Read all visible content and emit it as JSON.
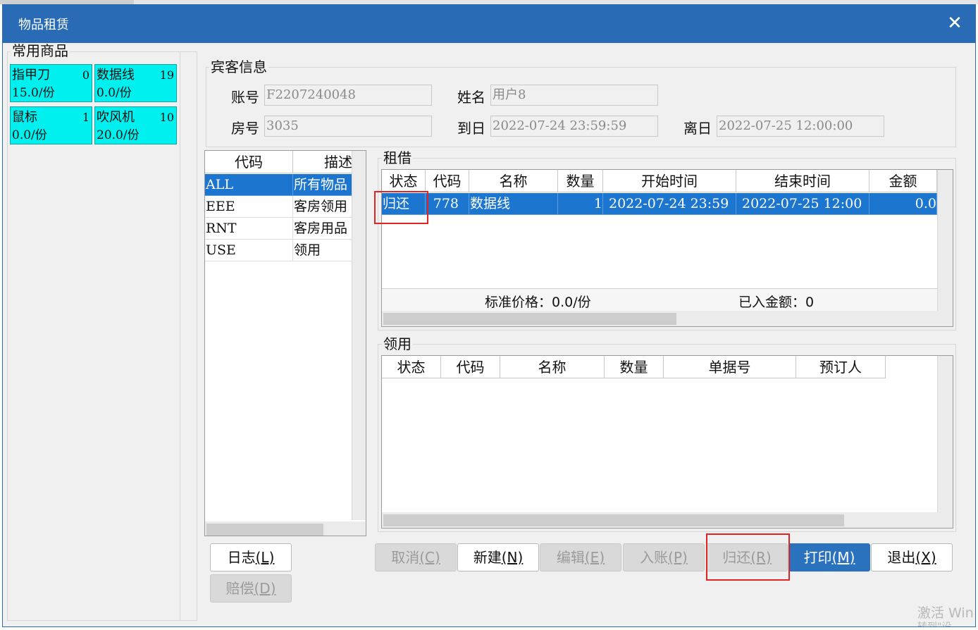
{
  "window": {
    "title": "物品租赁",
    "close_glyph": "✕"
  },
  "favorites": {
    "legend": "常用商品",
    "items": [
      {
        "name": "指甲刀",
        "count": "0",
        "price": "15.0/份"
      },
      {
        "name": "数据线",
        "count": "19",
        "price": "0.0/份"
      },
      {
        "name": "鼠标",
        "count": "1",
        "price": "0.0/份"
      },
      {
        "name": "吹风机",
        "count": "10",
        "price": "20.0/份"
      }
    ]
  },
  "guest": {
    "legend": "宾客信息",
    "account_label": "账号",
    "account": "F2207240048",
    "name_label": "姓名",
    "name": "用户8",
    "room_label": "房号",
    "room": "3035",
    "arrival_label": "到日",
    "arrival": "2022-07-24 23:59:59",
    "departure_label": "离日",
    "departure": "2022-07-25 12:00:00"
  },
  "categories": {
    "headers": [
      "代码",
      "描述"
    ],
    "rows": [
      {
        "code": "ALL",
        "desc": "所有物品"
      },
      {
        "code": "EEE",
        "desc": "客房领用"
      },
      {
        "code": "RNT",
        "desc": "客房用品"
      },
      {
        "code": "USE",
        "desc": "领用"
      }
    ]
  },
  "rental": {
    "legend": "租借",
    "headers": [
      "状态",
      "代码",
      "名称",
      "数量",
      "开始时间",
      "结束时间",
      "金额"
    ],
    "rows": [
      {
        "status": "归还",
        "code": "778",
        "name": "数据线",
        "qty": "1",
        "start": "2022-07-24 23:59",
        "end": "2022-07-25 12:00",
        "amount": "0.0"
      }
    ],
    "std_price": "标准价格：0.0/份",
    "posted_amount": "已入金额：0"
  },
  "usage": {
    "legend": "领用",
    "headers": [
      "状态",
      "代码",
      "名称",
      "数量",
      "单据号",
      "预订人"
    ]
  },
  "buttons": {
    "log": {
      "text": "日志",
      "key": "(L)"
    },
    "compensate": {
      "text": "赔偿",
      "key": "(D)"
    },
    "cancel": {
      "text": "取消",
      "key": "(C)"
    },
    "new": {
      "text": "新建",
      "key": "(N)"
    },
    "edit": {
      "text": "编辑",
      "key": "(E)"
    },
    "post": {
      "text": "入账",
      "key": "(P)"
    },
    "return": {
      "text": "归还",
      "key": "(R)"
    },
    "print": {
      "text": "打印",
      "key": "(M)"
    },
    "exit": {
      "text": "退出",
      "key": "(X)"
    }
  },
  "watermark": {
    "line1": "激活 Win",
    "line2": "转到\"设置\"以"
  },
  "colors": {
    "titlebar": "#2a6bb5",
    "tile": "#00f0ef",
    "selection": "#1c76d0",
    "highlight": "#e02323"
  }
}
